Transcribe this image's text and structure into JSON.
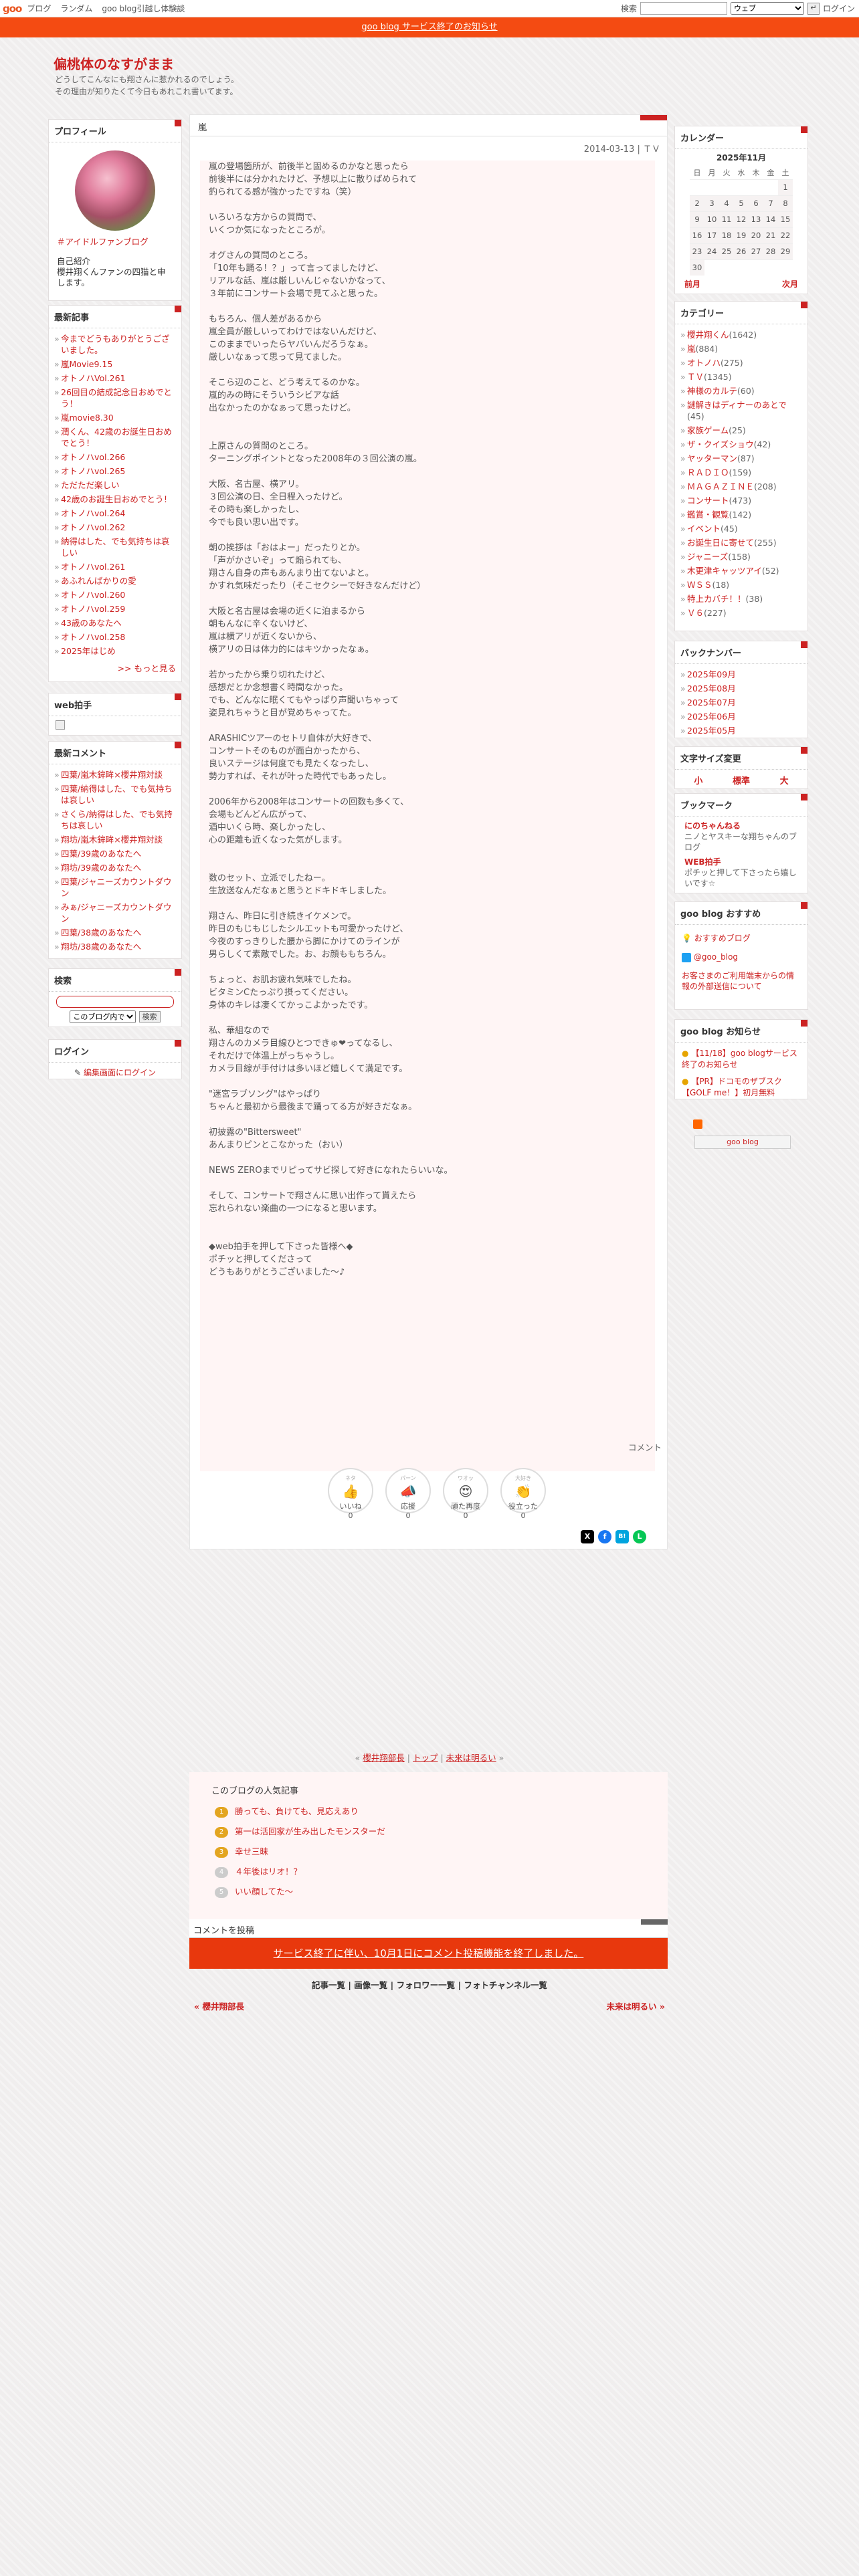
{
  "topnav": {
    "logo": "goo",
    "links": [
      "ブログ",
      "ランダム",
      "goo blog引越し体験談"
    ],
    "search_label": "検索",
    "search_scope": "ウェブ",
    "login": "ログイン"
  },
  "notice": "goo blog サービス終了のお知らせ",
  "blog": {
    "title": "偏桃体のなすがまま",
    "desc1": "どうしてこんなにも翔さんに惹かれるのでしょう。",
    "desc2": "その理由が知りたくて今日もあれこれ書いてます。"
  },
  "profile": {
    "title": "プロフィール",
    "link": "＃アイドルファンブログ",
    "intro_label": "自己紹介",
    "intro": "櫻井翔くんファンの四猫と申します。"
  },
  "recent": {
    "title": "最新記事",
    "items": [
      "今までどうもありがとうございました。",
      "嵐Movie9.15",
      "オトノハVol.261",
      "26回目の結成記念日おめでとう！",
      "嵐movie8.30",
      "潤くん、42歳のお誕生日おめでとう！",
      "オトノハvol.266",
      "オトノハvol.265",
      "ただただ楽しい",
      "42歳のお誕生日おめでとう！",
      "オトノハvol.264",
      "オトノハvol.262",
      "納得はした、でも気持ちは哀しい",
      "オトノハvol.261",
      "あふれんばかりの愛",
      "オトノハvol.260",
      "オトノハvol.259",
      "43歳のあなたへ",
      "オトノハvol.258",
      "2025年はじめ"
    ],
    "more": ">> もっと見る"
  },
  "webclap": {
    "title": "web拍手"
  },
  "comments": {
    "title": "最新コメント",
    "items": [
      "四葉/嵐木鉾眸×櫻井翔対談",
      "四葉/納得はした、でも気持ちは哀しい",
      "さくら/納得はした、でも気持ちは哀しい",
      "翔坊/嵐木鉾眸×櫻井翔対談",
      "四葉/39歳のあなたへ",
      "翔坊/39歳のあなたへ",
      "四葉/ジャニーズカウントダウン",
      "みぁ/ジャニーズカウントダウン",
      "四葉/38歳のあなたへ",
      "翔坊/38歳のあなたへ"
    ]
  },
  "search": {
    "title": "検索",
    "scope": "このブログ内で",
    "button": "検索"
  },
  "login": {
    "title": "ログイン",
    "link": "編集画面にログイン"
  },
  "calendar": {
    "title": "カレンダー",
    "month": "2025年11月",
    "days": [
      "日",
      "月",
      "火",
      "水",
      "木",
      "金",
      "土"
    ],
    "weeks": [
      [
        "",
        "",
        "",
        "",
        "",
        "",
        "1"
      ],
      [
        "2",
        "3",
        "4",
        "5",
        "6",
        "7",
        "8"
      ],
      [
        "9",
        "10",
        "11",
        "12",
        "13",
        "14",
        "15"
      ],
      [
        "16",
        "17",
        "18",
        "19",
        "20",
        "21",
        "22"
      ],
      [
        "23",
        "24",
        "25",
        "26",
        "27",
        "28",
        "29"
      ],
      [
        "30",
        "",
        "",
        "",
        "",
        "",
        ""
      ]
    ],
    "prev": "前月",
    "next": "次月"
  },
  "categories": {
    "title": "カテゴリー",
    "items": [
      [
        "櫻井翔くん",
        "(1642)"
      ],
      [
        "嵐",
        "(884)"
      ],
      [
        "オトノハ",
        "(275)"
      ],
      [
        "ＴＶ",
        "(1345)"
      ],
      [
        "神様のカルテ",
        "(60)"
      ],
      [
        "謎解きはディナーのあとで",
        "(45)"
      ],
      [
        "家族ゲーム",
        "(25)"
      ],
      [
        "ザ・クイズショウ",
        "(42)"
      ],
      [
        "ヤッターマン",
        "(87)"
      ],
      [
        "ＲＡＤＩＯ",
        "(159)"
      ],
      [
        "ＭＡＧＡＺＩＮＥ",
        "(208)"
      ],
      [
        "コンサート",
        "(473)"
      ],
      [
        "鑑賞・観覧",
        "(142)"
      ],
      [
        "イベント",
        "(45)"
      ],
      [
        "お誕生日に寄せて",
        "(255)"
      ],
      [
        "ジャニーズ",
        "(158)"
      ],
      [
        "木更津キャッツアイ",
        "(52)"
      ],
      [
        "ＷＳＳ",
        "(18)"
      ],
      [
        "特上カバチ！！",
        "(38)"
      ],
      [
        "Ｖ６",
        "(227)"
      ]
    ]
  },
  "backnumber": {
    "title": "バックナンバー",
    "items": [
      "2025年09月",
      "2025年08月",
      "2025年07月",
      "2025年06月",
      "2025年05月"
    ]
  },
  "fontsize": {
    "title": "文字サイズ変更",
    "small": "小",
    "mid": "標準",
    "large": "大"
  },
  "bookmark": {
    "title": "ブックマーク",
    "b1": "にのちゃんねる",
    "b1d": "ニノとヤスキーな翔ちゃんのブログ",
    "b2": "WEB拍手",
    "b2d": "ポチッと押して下さったら嬉しいです☆"
  },
  "goo_rec": {
    "title": "goo blog おすすめ",
    "l1": "おすすめブログ",
    "l2": "@goo_blog",
    "note": "お客さまのご利用端末からの情報の外部送信について"
  },
  "goo_news": {
    "title": "goo blog お知らせ",
    "n1": "【11/18】goo blogサービス終了のお知らせ",
    "n2": "【PR】ドコモのザブスク【GOLF me！】初月無料",
    "badge": "goo blog"
  },
  "article": {
    "category": "嵐",
    "date": "2014-03-13 | ＴＶ",
    "body": "嵐の登場箇所が、前後半と固めるのかなと思ったら\n前後半には分かれたけど、予想以上に散りばめられて\n釣られてる感が強かったですね（笑）\n\nいろいろな方からの質問で、\nいくつか気になったところが。\n\nオグさんの質問のところ。\n「10年も踊る！？」って言ってましたけど、\nリアルな話、嵐は厳しいんじゃないかなって、\n３年前にコンサート会場で見てふと思った。\n\nもちろん、個人差があるから\n嵐全員が厳しいってわけではないんだけど、\nこのままでいったらヤバいんだろうなぁ。\n厳しいなぁって思って見てました。\n\nそこら辺のこと、どう考えてるのかな。\n嵐的みの時にそういうシビアな話\n出なかったのかなぁって思ったけど。\n\n\n上原さんの質問のところ。\nターニングポイントとなった2008年の３回公演の嵐。\n\n大阪、名古屋、横アリ。\n３回公演の日、全日程入ったけど。\nその時も楽しかったし、\n今でも良い思い出です。\n\n朝の挨拶は「おはよー」だったりとか。\n「声がかさいぞ」って煽られても、\n翔さん自身の声もあんまり出てないよと。\nかすれ気味だったり（そこセクシーで好きなんだけど）\n\n大阪と名古屋は会場の近くに泊まるから\n朝もんなに辛くないけど、\n嵐は横アリが近くないから、\n横アリの日は体力的にはキツかったなぁ。\n\n若かったから乗り切れたけど、\n感想だとか念想書く時間なかった。\nでも、どんなに眠くてもやっぱり声聞いちゃって\n姿見れちゃうと目が覚めちゃってた。\n\nARASHICツアーのセトリ自体が大好きで、\nコンサートそのものが面白かったから、\n良いステージは何度でも見たくなったし、\n勢力すれば、それが叶った時代でもあったし。\n\n2006年から2008年はコンサートの回数も多くて、\n会場もどんどん広がって、\n酒中いくら時、楽しかったし、\n心の距離も近くなった気がします。\n\n\n数のセット、立派でしたねー。\n生放送なんだなぁと思うとドキドキしました。\n\n翔さん、昨日に引き続きイケメンで。\n昨日のもじもじしたシルエットも可愛かったけど、\n今夜のすっきりした腰から脚にかけてのラインが\n男らしくて素敵でした。お、お顔ももちろん。\n\nちょっと、お肌お疲れ気味でしたね。\nビタミンCたっぷり摂ってください。\n身体のキレは凄くてかっこよかったです。\n\n私、華組なので\n翔さんのカメラ目線ひとつできゅ❤ってなるし、\nそれだけで体温上がっちゃうし。\nカメラ目線が手付けは多いほど嬉しくて満足です。\n\n\"迷宮ラブソング\"はやっぱり\nちゃんと最初から最後まで踊ってる方が好きだなぁ。\n\n初披露の\"Bittersweet\"\nあんまりピンとこなかった（おい）\n\nNEWS ZEROまでリピってサビ探して好きになれたらいいな。\n\nそして、コンサートで翔さんに思い出作って貰えたら\n忘れられない楽曲の一つになると思います。\n\n\n◆web拍手を押して下さった皆様へ◆\nポチッと押してくださって\nどうもありがとうございました〜♪",
    "comment_label": "コメント"
  },
  "reactions": [
    {
      "label": "いいね",
      "glyph": "👍",
      "count": "0"
    },
    {
      "label": "応援",
      "glyph": "📣",
      "count": "0"
    },
    {
      "label": "頑た再度",
      "glyph": "😍",
      "count": "0"
    },
    {
      "label": "役立った",
      "glyph": "👏",
      "count": "0"
    }
  ],
  "reaction_top": [
    "ネタ",
    "パーン",
    "ワオッ",
    "大好き"
  ],
  "share": [
    "X",
    "f",
    "B!",
    "L"
  ],
  "pager": {
    "prev": "櫻井翔部長",
    "top": "トップ",
    "next": "未来は明るい"
  },
  "popular": {
    "title": "このブログの人気記事",
    "items": [
      "勝っても、負けても、見応えあり",
      "第一は活回家が生み出したモンスターだ",
      "幸せ三昧",
      "４年後はリオ！？",
      "いい顔してた〜"
    ]
  },
  "comment_form": {
    "title": "コメントを投稿",
    "notice": "サービス終了に伴い、10月1日にコメント投稿機能を終了しました。"
  },
  "footer": {
    "links": [
      "記事一覧",
      "画像一覧",
      "フォロワー一覧",
      "フォトチャンネル一覧"
    ],
    "prev": "櫻井翔部長",
    "next": "未来は明るい"
  }
}
